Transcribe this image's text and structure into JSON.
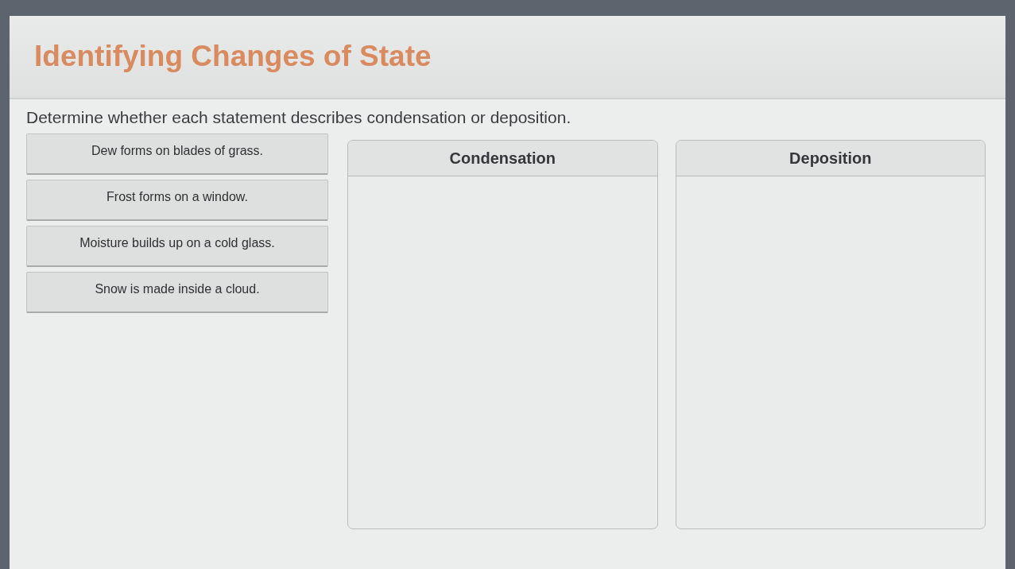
{
  "title": "Identifying Changes of State",
  "instructions": "Determine whether each statement describes condensation or deposition.",
  "statements": [
    {
      "text": "Dew forms on blades of grass."
    },
    {
      "text": "Frost forms on a window."
    },
    {
      "text": "Moisture builds up on a cold glass."
    },
    {
      "text": "Snow is made inside a cloud."
    }
  ],
  "categories": [
    {
      "label": "Condensation"
    },
    {
      "label": "Deposition"
    }
  ]
}
